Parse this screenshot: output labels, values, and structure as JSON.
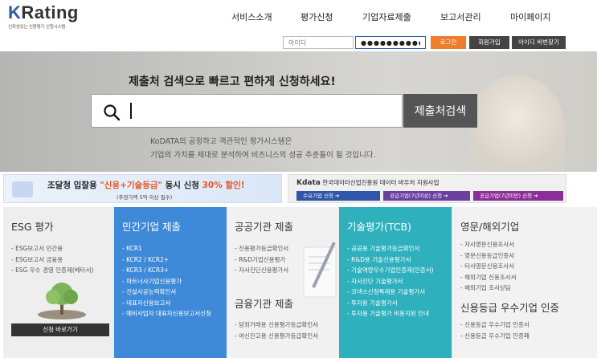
{
  "header": {
    "logo_text": "KRating",
    "logo_sub": "신뢰성있는 신용평가 신청시스템",
    "nav": [
      "서비스소개",
      "평가신청",
      "기업자료제출",
      "보고서관리",
      "마이페이지"
    ]
  },
  "login": {
    "id_value": "",
    "id_placeholder": "아이디",
    "pw_value": "●●●●●●●●●●●",
    "login_label": "로그인",
    "join_label": "회원가입",
    "find_label": "아이디 비번찾기"
  },
  "hero": {
    "title": "제출처 검색으로 빠르고 편하게 신청하세요!",
    "search_value": "",
    "search_button": "제출처검색",
    "desc_line1": "KoDATA의 공정하고 객관적인 평가시스템은",
    "desc_line2": "기업의 가치를 제대로 분석하여 비즈니스의 성공 추춘돌이 될 것입니다."
  },
  "banner1": {
    "prefix": "조달청 입찰용 ",
    "highlight": "\"신용+기술등급\"",
    "middle": " 동시 신청 ",
    "discount": "30%",
    "suffix": " 할인!",
    "note": "(추정가액 5억 이상 필수)"
  },
  "banner2": {
    "logo": "Kdata",
    "org": "한국데이터산업진흥원",
    "title": "데이터 바우처 지원사업",
    "buttons": [
      "수요기업 신청",
      "공급기업(7년이상) 신청",
      "공급기업(7년미만) 신청"
    ],
    "button_arrow": "➔"
  },
  "cards": {
    "esg": {
      "title": "ESG 평가",
      "items": [
        "- ESG보고서 민간용",
        "- ESG보고서 금융용",
        "- ESG 우수 경영 인증제(베타서)"
      ],
      "button": "신청 바로가기"
    },
    "private": {
      "title": "민간기업 제출",
      "items": [
        "- KCR1",
        "- KCR2 / KCR2+",
        "- KCR3 / KCR3+",
        "- 파트너사기업신용평가",
        "- 건설사공능력확인서",
        "- 대표자신용보고서",
        "- 예비사업자 대표자신용보고서신청"
      ]
    },
    "public": {
      "title": "공공기관 제출",
      "items": [
        "- 신용평가등급확인서",
        "- R&D기업신용평가",
        "- 자사진단신용평가서"
      ],
      "title2": "금융기관 제출",
      "items2": [
        "- 당좌거래용 신용평가등급확인서",
        "- 여신잔고용 신용평가등급확인서"
      ]
    },
    "tcb": {
      "title": "기술평가(TCB)",
      "items": [
        "- 공공용 기술평가등급확인서",
        "- R&D용 기술신용평가서",
        "- 기술역량우수기업인증제(인증서)",
        "- 자사진단 기술평가서",
        "- 코넥스신청특례용 기술평가서",
        "- 투자용 기술평가서",
        "- 투자용 기술평가 비용지원 안내"
      ]
    },
    "overseas": {
      "title": "영문/해외기업",
      "items": [
        "- 자사영문신용조사서",
        "- 영문신용등급인증서",
        "- 타사영문신용조사서",
        "- 해외기업 신용조사서",
        "- 해외기업 조사상담"
      ],
      "title2": "신용등급 우수기업 인증",
      "items2": [
        "- 신용등급 우수기업 인증서",
        "- 신용등급 우수기업 인증패"
      ]
    }
  }
}
